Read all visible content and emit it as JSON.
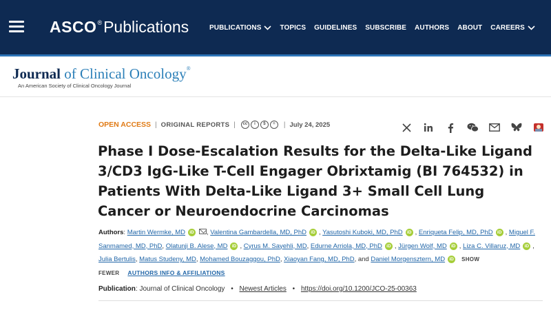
{
  "header": {
    "brand_main": "ASCO",
    "brand_reg": "®",
    "brand_sub": "Publications",
    "nav": [
      {
        "label": "PUBLICATIONS",
        "dropdown": true
      },
      {
        "label": "TOPICS",
        "dropdown": false
      },
      {
        "label": "GUIDELINES",
        "dropdown": false
      },
      {
        "label": "SUBSCRIBE",
        "dropdown": false
      },
      {
        "label": "AUTHORS",
        "dropdown": false
      },
      {
        "label": "ABOUT",
        "dropdown": false
      },
      {
        "label": "CAREERS",
        "dropdown": true
      }
    ]
  },
  "journal": {
    "name_part1": "Journal",
    "name_part2": " of Clinical Oncology",
    "reg": "®",
    "subtitle": "An American Society of Clinical Oncology Journal"
  },
  "article": {
    "access": "OPEN ACCESS",
    "type": "ORIGINAL REPORTS",
    "license_icons": [
      "cc",
      "by",
      "nc",
      "nd"
    ],
    "date": "July 24, 2025",
    "title": "Phase I Dose-Escalation Results for the Delta-Like Ligand 3/CD3 IgG-Like T-Cell Engager Obrixtamig (BI 764532) in Patients With Delta-Like Ligand 3+ Small Cell Lung Cancer or Neuroendocrine Carcinomas",
    "authors_label": "Authors",
    "authors": [
      {
        "name": "Martin Wermke, MD",
        "orcid": true,
        "mail": true
      },
      {
        "name": "Valentina Gambardella, MD, PhD",
        "orcid": true
      },
      {
        "name": "Yasutoshi Kuboki, MD, PhD",
        "orcid": true
      },
      {
        "name": "Enriqueta Felip, MD, PhD",
        "orcid": true
      },
      {
        "name": "Miguel F. Sanmamed, MD, PhD",
        "orcid": false
      },
      {
        "name": "Olatunji B. Alese, MD",
        "orcid": true
      },
      {
        "name": "Cyrus M. Sayehli, MD",
        "orcid": false
      },
      {
        "name": "Edurne Arriola, MD, PhD",
        "orcid": true
      },
      {
        "name": "Jürgen Wolf, MD",
        "orcid": true
      },
      {
        "name": "Liza C. Villaruz, MD",
        "orcid": true
      },
      {
        "name": "Julia Bertulis",
        "orcid": false
      },
      {
        "name": "Matus Studeny, MD",
        "orcid": false
      },
      {
        "name": "Mohamed Bouzaggou, PhD",
        "orcid": false
      },
      {
        "name": "Xiaoyan Fang, MD, PhD",
        "orcid": false
      },
      {
        "name": "Daniel Morgensztern, MD",
        "orcid": true
      }
    ],
    "and_word": "and",
    "show_fewer": "SHOW FEWER",
    "affiliations": "AUTHORS INFO & AFFILIATIONS",
    "publication_label": "Publication",
    "publication_journal": "Journal of Clinical Oncology",
    "newest_articles": "Newest Articles",
    "doi": "https://doi.org/10.1200/JCO-25-00363"
  },
  "share_icons": [
    "x-icon",
    "linkedin-icon",
    "facebook-icon",
    "wechat-icon",
    "email-icon",
    "bluesky-icon",
    "mendeley-icon"
  ],
  "colors": {
    "navbar": "#0e2a52",
    "accent_blue": "#2b7fb8",
    "open_access": "#e07a14",
    "orcid": "#a6ce39",
    "link": "#2166a8"
  }
}
